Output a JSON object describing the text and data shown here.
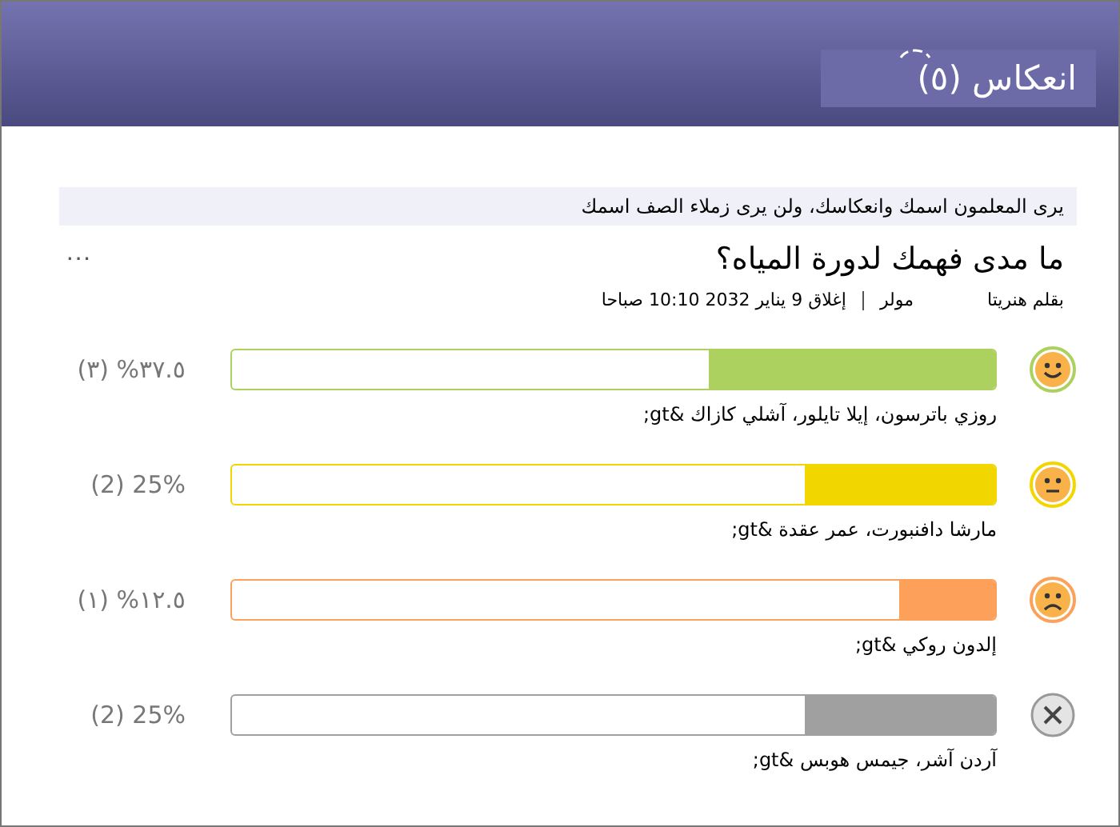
{
  "header": {
    "title": "انعكاس (٥)"
  },
  "notice": "يرى المعلمون اسمك وانعكاسك، ولن يرى زملاء الصف اسمك",
  "question": "ما مدى فهمك لدورة المياه؟",
  "more": "···",
  "meta": {
    "author": "بقلم هنريتا",
    "author_last": "مولر",
    "closing": "إغلاق 9 يناير 2032 10:10 صباحا"
  },
  "responses": [
    {
      "kind": "happy",
      "color": "#acd15e",
      "level": 0.375,
      "reading": "٣٧.٥% (٣)",
      "names": "روزي باترسون، إيلا تايلور، آشلي كازاك &gt;"
    },
    {
      "kind": "neutral",
      "color": "#f2d600",
      "level": 0.25,
      "reading": "25% (2)",
      "names": "مارشا دافنبورت، عمر عقدة &gt;"
    },
    {
      "kind": "sad",
      "color": "#fca05a",
      "level": 0.125,
      "reading": "١٢.٥% (١)",
      "names": "إلدون روكي &gt;"
    },
    {
      "kind": "none",
      "color": "#a0a0a0",
      "level": 0.25,
      "reading": "25% (2)",
      "names": "آردن آشر، جيمس هوبس &gt;"
    }
  ]
}
